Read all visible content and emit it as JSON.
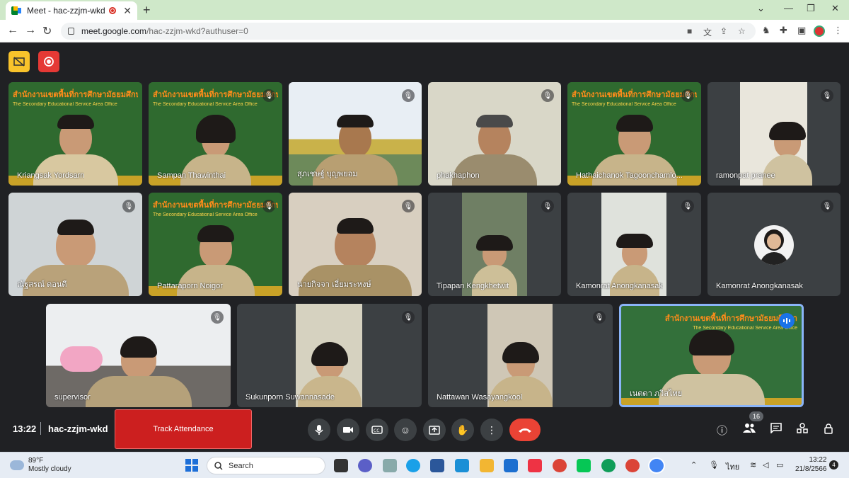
{
  "browser": {
    "tab_title": "Meet - hac-zzjm-wkd",
    "new_tab": "+",
    "url_host": "meet.google.com",
    "url_path": "/hac-zzjm-wkd?authuser=0"
  },
  "meeting": {
    "time": "13:22",
    "code": "hac-zzjm-wkd",
    "track_attendance": "Track Attendance",
    "people_count": "16",
    "accent": "#8ab4f8",
    "end_call_color": "#ea4335"
  },
  "tiles": [
    {
      "name": "Kriangsak Yordsarn"
    },
    {
      "name": "Sampan Thawinthai"
    },
    {
      "name": "สุภเชษฐ์ บุญพยอม"
    },
    {
      "name": "phakhaphon"
    },
    {
      "name": "Hathaichanok Tagoonchamlo..."
    },
    {
      "name": "ramonpat pranee"
    },
    {
      "name": "ณัฐสรณ์ ดอนดี"
    },
    {
      "name": "Pattaraporn Noigor"
    },
    {
      "name": "นายกิจจา เอี่ยมระหงษ์"
    },
    {
      "name": "Tipapan Kengkhetwit"
    },
    {
      "name": "Kamonrat Anongkanasak"
    },
    {
      "name": "Kamonrat Anongkanasak"
    },
    {
      "name": "supervisor"
    },
    {
      "name": "Sukunporn Suwannasade"
    },
    {
      "name": "Nattawan Wasayangkool"
    },
    {
      "name": "เนตดา ภวิสไทย"
    }
  ],
  "taskbar": {
    "temp": "89°F",
    "condition": "Mostly cloudy",
    "search": "Search",
    "language": "ไทย",
    "clock": "13:22",
    "date": "21/8/2566",
    "notifications": "4"
  }
}
